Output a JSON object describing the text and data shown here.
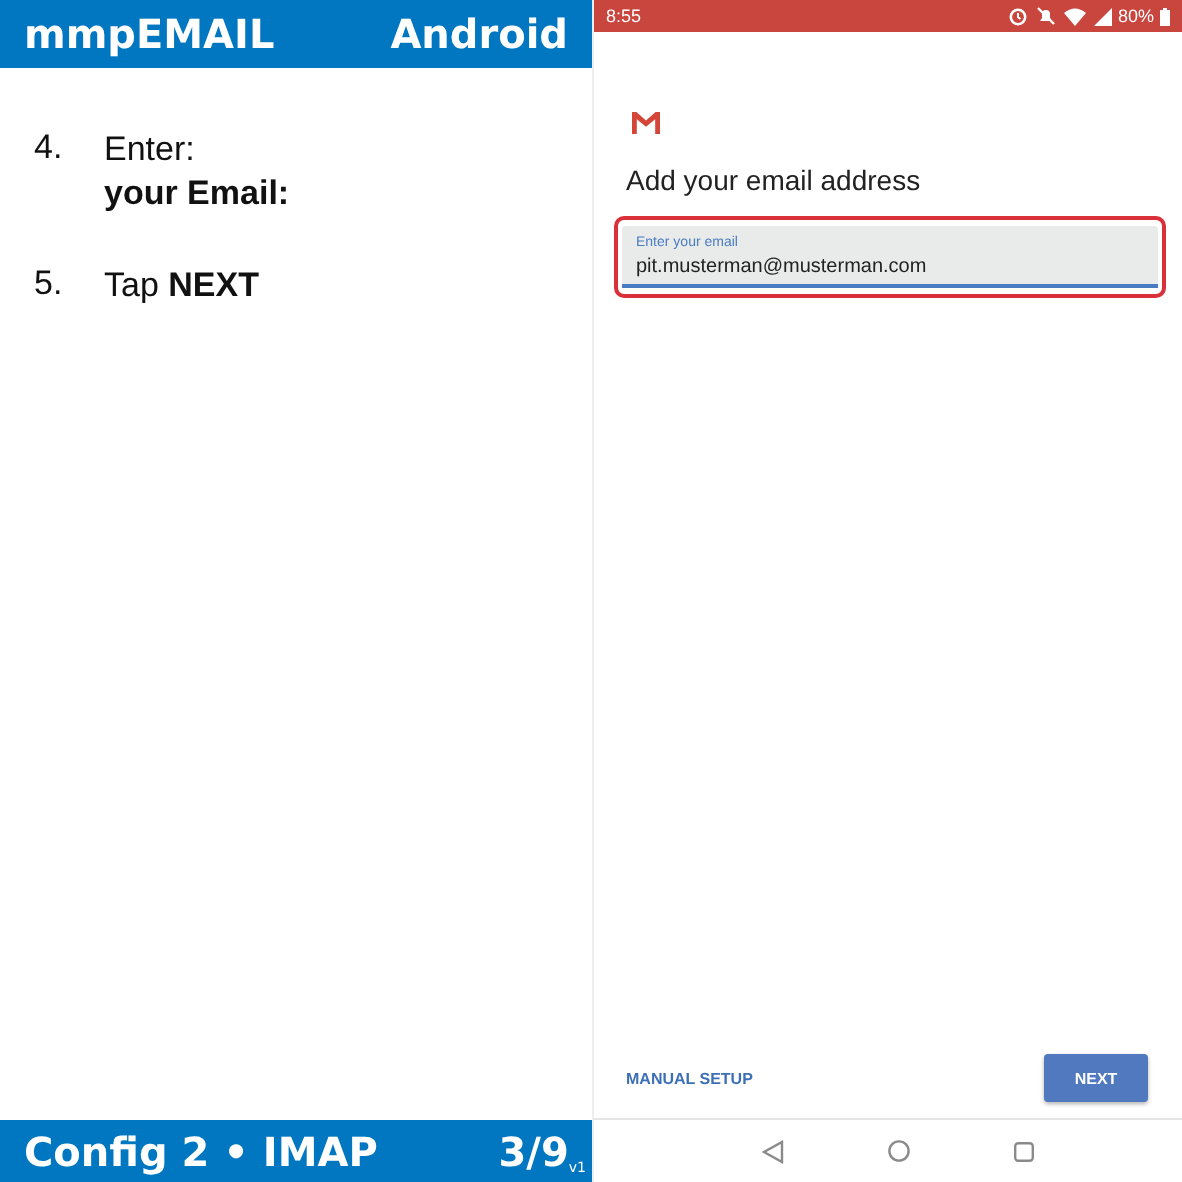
{
  "guide": {
    "header": {
      "title": "mmpEMAIL",
      "platform": "Android"
    },
    "steps": [
      {
        "number": "4.",
        "lines": [
          "Enter:",
          "**your Email:**"
        ]
      },
      {
        "number": "5.",
        "lines": [
          "Tap **NEXT**"
        ]
      }
    ],
    "footer": {
      "title": "Config 2 • IMAP",
      "page": "3/9",
      "version": "v1"
    }
  },
  "phone": {
    "status_bar": {
      "time": "8:55",
      "battery": "80%"
    },
    "heading": "Add your email address",
    "email_field": {
      "label": "Enter your email",
      "value": "pit.musterman@musterman.com",
      "highlighted": true
    },
    "buttons": [
      {
        "label": "MANUAL SETUP",
        "kind": "text"
      },
      {
        "label": "NEXT",
        "kind": "filled"
      }
    ]
  }
}
